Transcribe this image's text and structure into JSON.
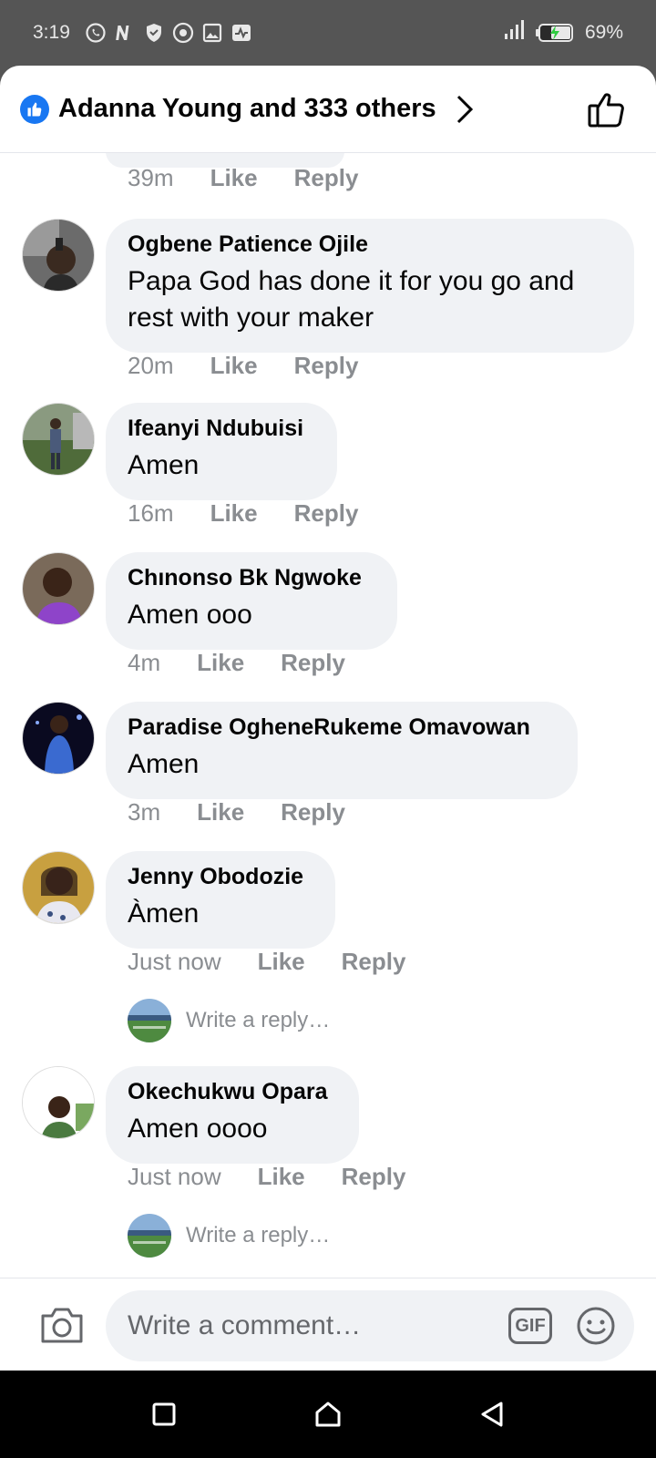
{
  "status_bar": {
    "time": "3:19",
    "battery": "69%",
    "icons": [
      "whatsapp-icon",
      "n-icon",
      "shield-icon",
      "chrome-icon",
      "gallery-icon",
      "activity-icon"
    ]
  },
  "header": {
    "title": "Adanna Young and 333 others"
  },
  "actions": {
    "like": "Like",
    "reply": "Reply"
  },
  "comments": [
    {
      "time": "39m"
    },
    {
      "author": "Ogbene Patience Ojile",
      "text": "Papa God has done it for you go and rest with your maker",
      "time": "20m"
    },
    {
      "author": "Ifeanyi Ndubuisi",
      "text": "Amen",
      "time": "16m"
    },
    {
      "author": "Chınonso Bk Ngwoke",
      "text": "Amen ooo",
      "time": "4m"
    },
    {
      "author": "Paradise OgheneRukeme Omavowan",
      "text": "Amen",
      "time": "3m"
    },
    {
      "author": "Jenny Obodozie",
      "text": "Àmen",
      "time": "Just now",
      "reply_placeholder": "Write a reply…"
    },
    {
      "author": "Okechukwu Opara",
      "text": "Amen oooo",
      "time": "Just now",
      "reply_placeholder": "Write a reply…"
    }
  ],
  "composer": {
    "placeholder": "Write a comment…",
    "gif_label": "GIF"
  },
  "colors": {
    "brand_blue": "#1877f2",
    "bubble_bg": "#f0f2f5",
    "meta_gray": "#8a8d91"
  }
}
